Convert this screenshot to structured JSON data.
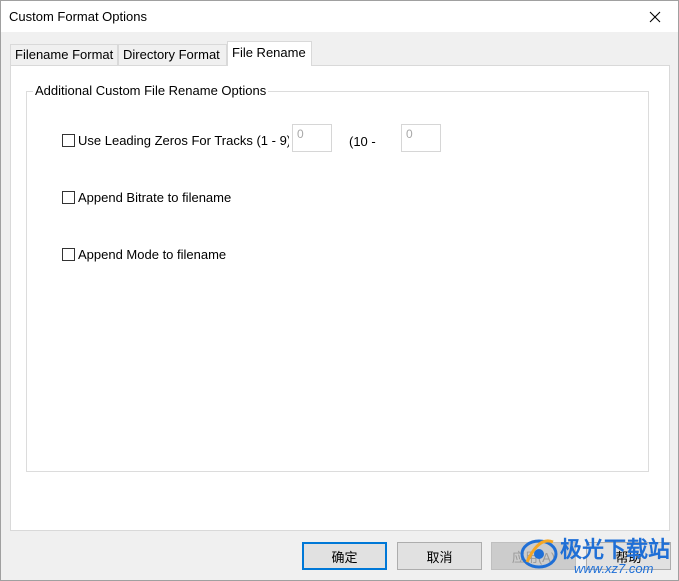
{
  "window": {
    "title": "Custom Format Options"
  },
  "tabs": [
    {
      "label": "Filename Format",
      "active": false
    },
    {
      "label": "Directory Format",
      "active": false
    },
    {
      "label": "File Rename",
      "active": true
    }
  ],
  "group": {
    "legend": "Additional Custom File Rename Options",
    "leading_zeros": {
      "label": "Use Leading Zeros For Tracks (1 - 9)",
      "checked": false,
      "value_1_9": "0",
      "range_label": "(10 -",
      "value_10": "0"
    },
    "append_bitrate": {
      "label": "Append Bitrate to filename",
      "checked": false
    },
    "append_mode": {
      "label": "Append Mode to filename",
      "checked": false
    }
  },
  "buttons": {
    "ok": "确定",
    "cancel": "取消",
    "apply": "应用(A)",
    "help": "帮助"
  },
  "watermark": {
    "line1": "极光下载站",
    "line2": "www.xz7.com",
    "accent": "#1f6fd6"
  }
}
